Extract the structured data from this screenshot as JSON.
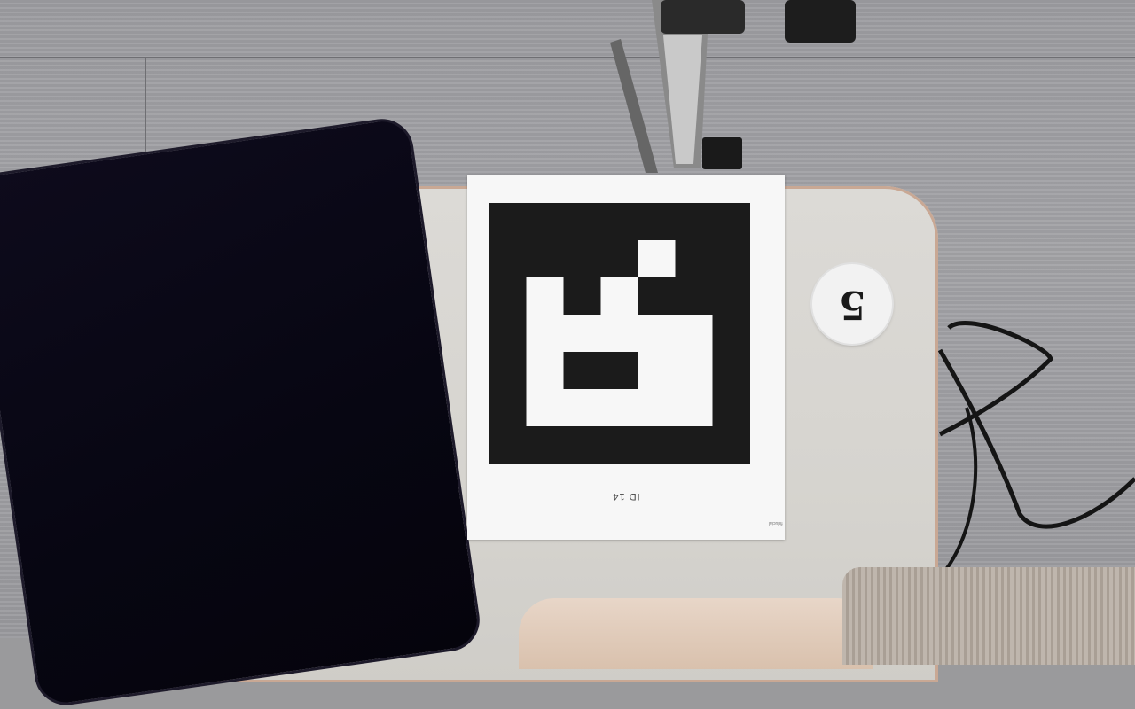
{
  "scene": {
    "marker_label": "ID 14",
    "marker_credit": "fiducial",
    "token_number": "5",
    "marker_grid": [
      [
        0,
        0,
        0,
        0,
        0,
        0,
        0
      ],
      [
        0,
        0,
        0,
        0,
        1,
        0,
        0
      ],
      [
        0,
        1,
        0,
        1,
        0,
        0,
        0
      ],
      [
        0,
        1,
        1,
        1,
        1,
        1,
        0
      ],
      [
        0,
        1,
        0,
        0,
        1,
        1,
        0
      ],
      [
        0,
        1,
        1,
        1,
        1,
        1,
        0
      ],
      [
        0,
        0,
        0,
        0,
        0,
        0,
        0
      ]
    ]
  },
  "colors": {
    "marker_black": "#1b1b1b",
    "marker_white": "#f7f7f7",
    "tablet": "#08061a"
  }
}
